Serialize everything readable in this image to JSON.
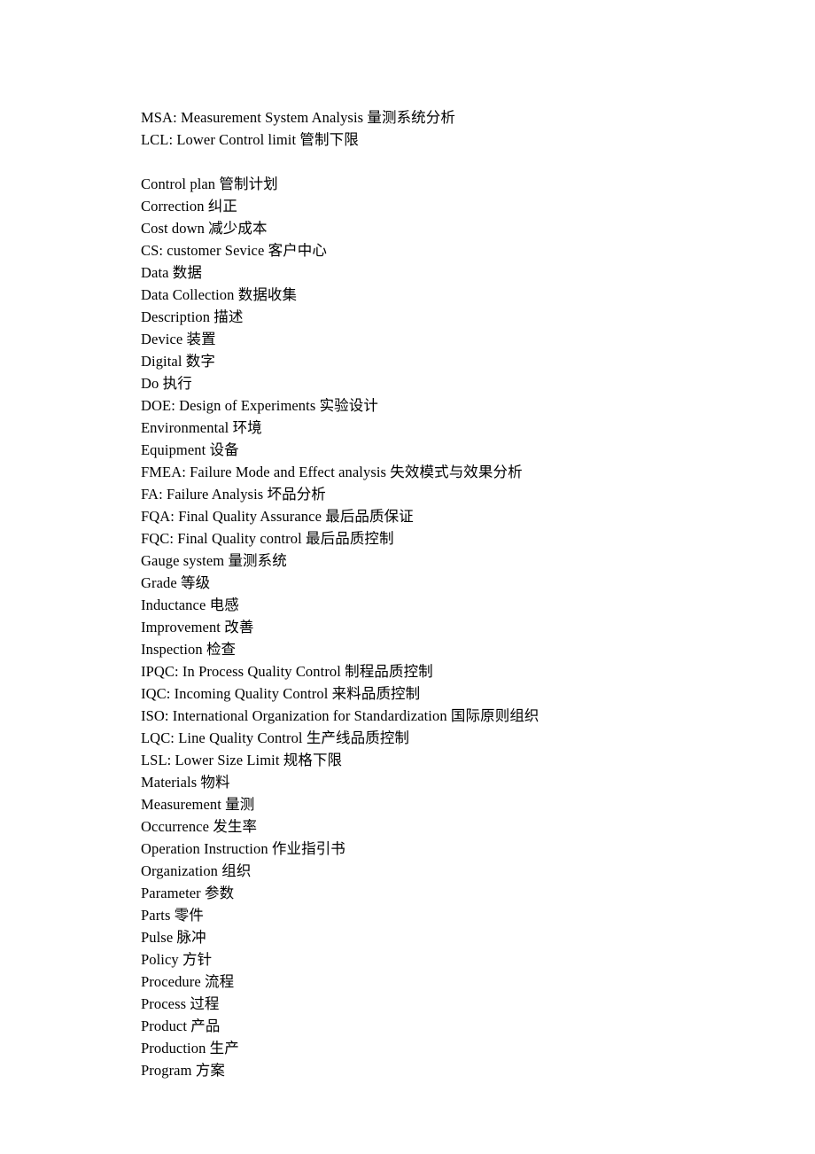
{
  "lines_group1": [
    "MSA: Measurement System Analysis  量测系统分析",
    "LCL: Lower Control limit  管制下限"
  ],
  "lines_group2": [
    "Control plan  管制计划",
    "Correction  纠正",
    "Cost down  减少成本",
    "CS: customer Sevice  客户中心",
    "Data  数据",
    "Data Collection  数据收集",
    "Description  描述",
    "Device  装置",
    "Digital  数字",
    "Do  执行",
    "DOE: Design of Experiments  实验设计",
    "Environmental  环境",
    "Equipment  设备",
    "FMEA: Failure Mode and Effect analysis  失效模式与效果分析",
    "FA: Failure Analysis  坏品分析",
    "FQA: Final Quality Assurance  最后品质保证",
    "FQC: Final Quality control  最后品质控制",
    "Gauge system  量测系统",
    "Grade  等级",
    "Inductance  电感",
    "Improvement  改善",
    "Inspection  检查",
    "IPQC: In Process Quality Control  制程品质控制",
    "IQC: Incoming Quality Control  来料品质控制",
    "ISO: International Organization for Standardization  国际原则组织",
    "LQC: Line Quality Control  生产线品质控制",
    "LSL: Lower Size Limit  规格下限",
    "Materials  物料",
    "Measurement  量测",
    "Occurrence  发生率",
    "Operation Instruction  作业指引书",
    "Organization  组织",
    "Parameter  参数",
    "Parts  零件",
    "Pulse  脉冲",
    "Policy  方针",
    "Procedure  流程",
    "Process  过程",
    "Product  产品",
    "Production  生产",
    "Program  方案"
  ]
}
